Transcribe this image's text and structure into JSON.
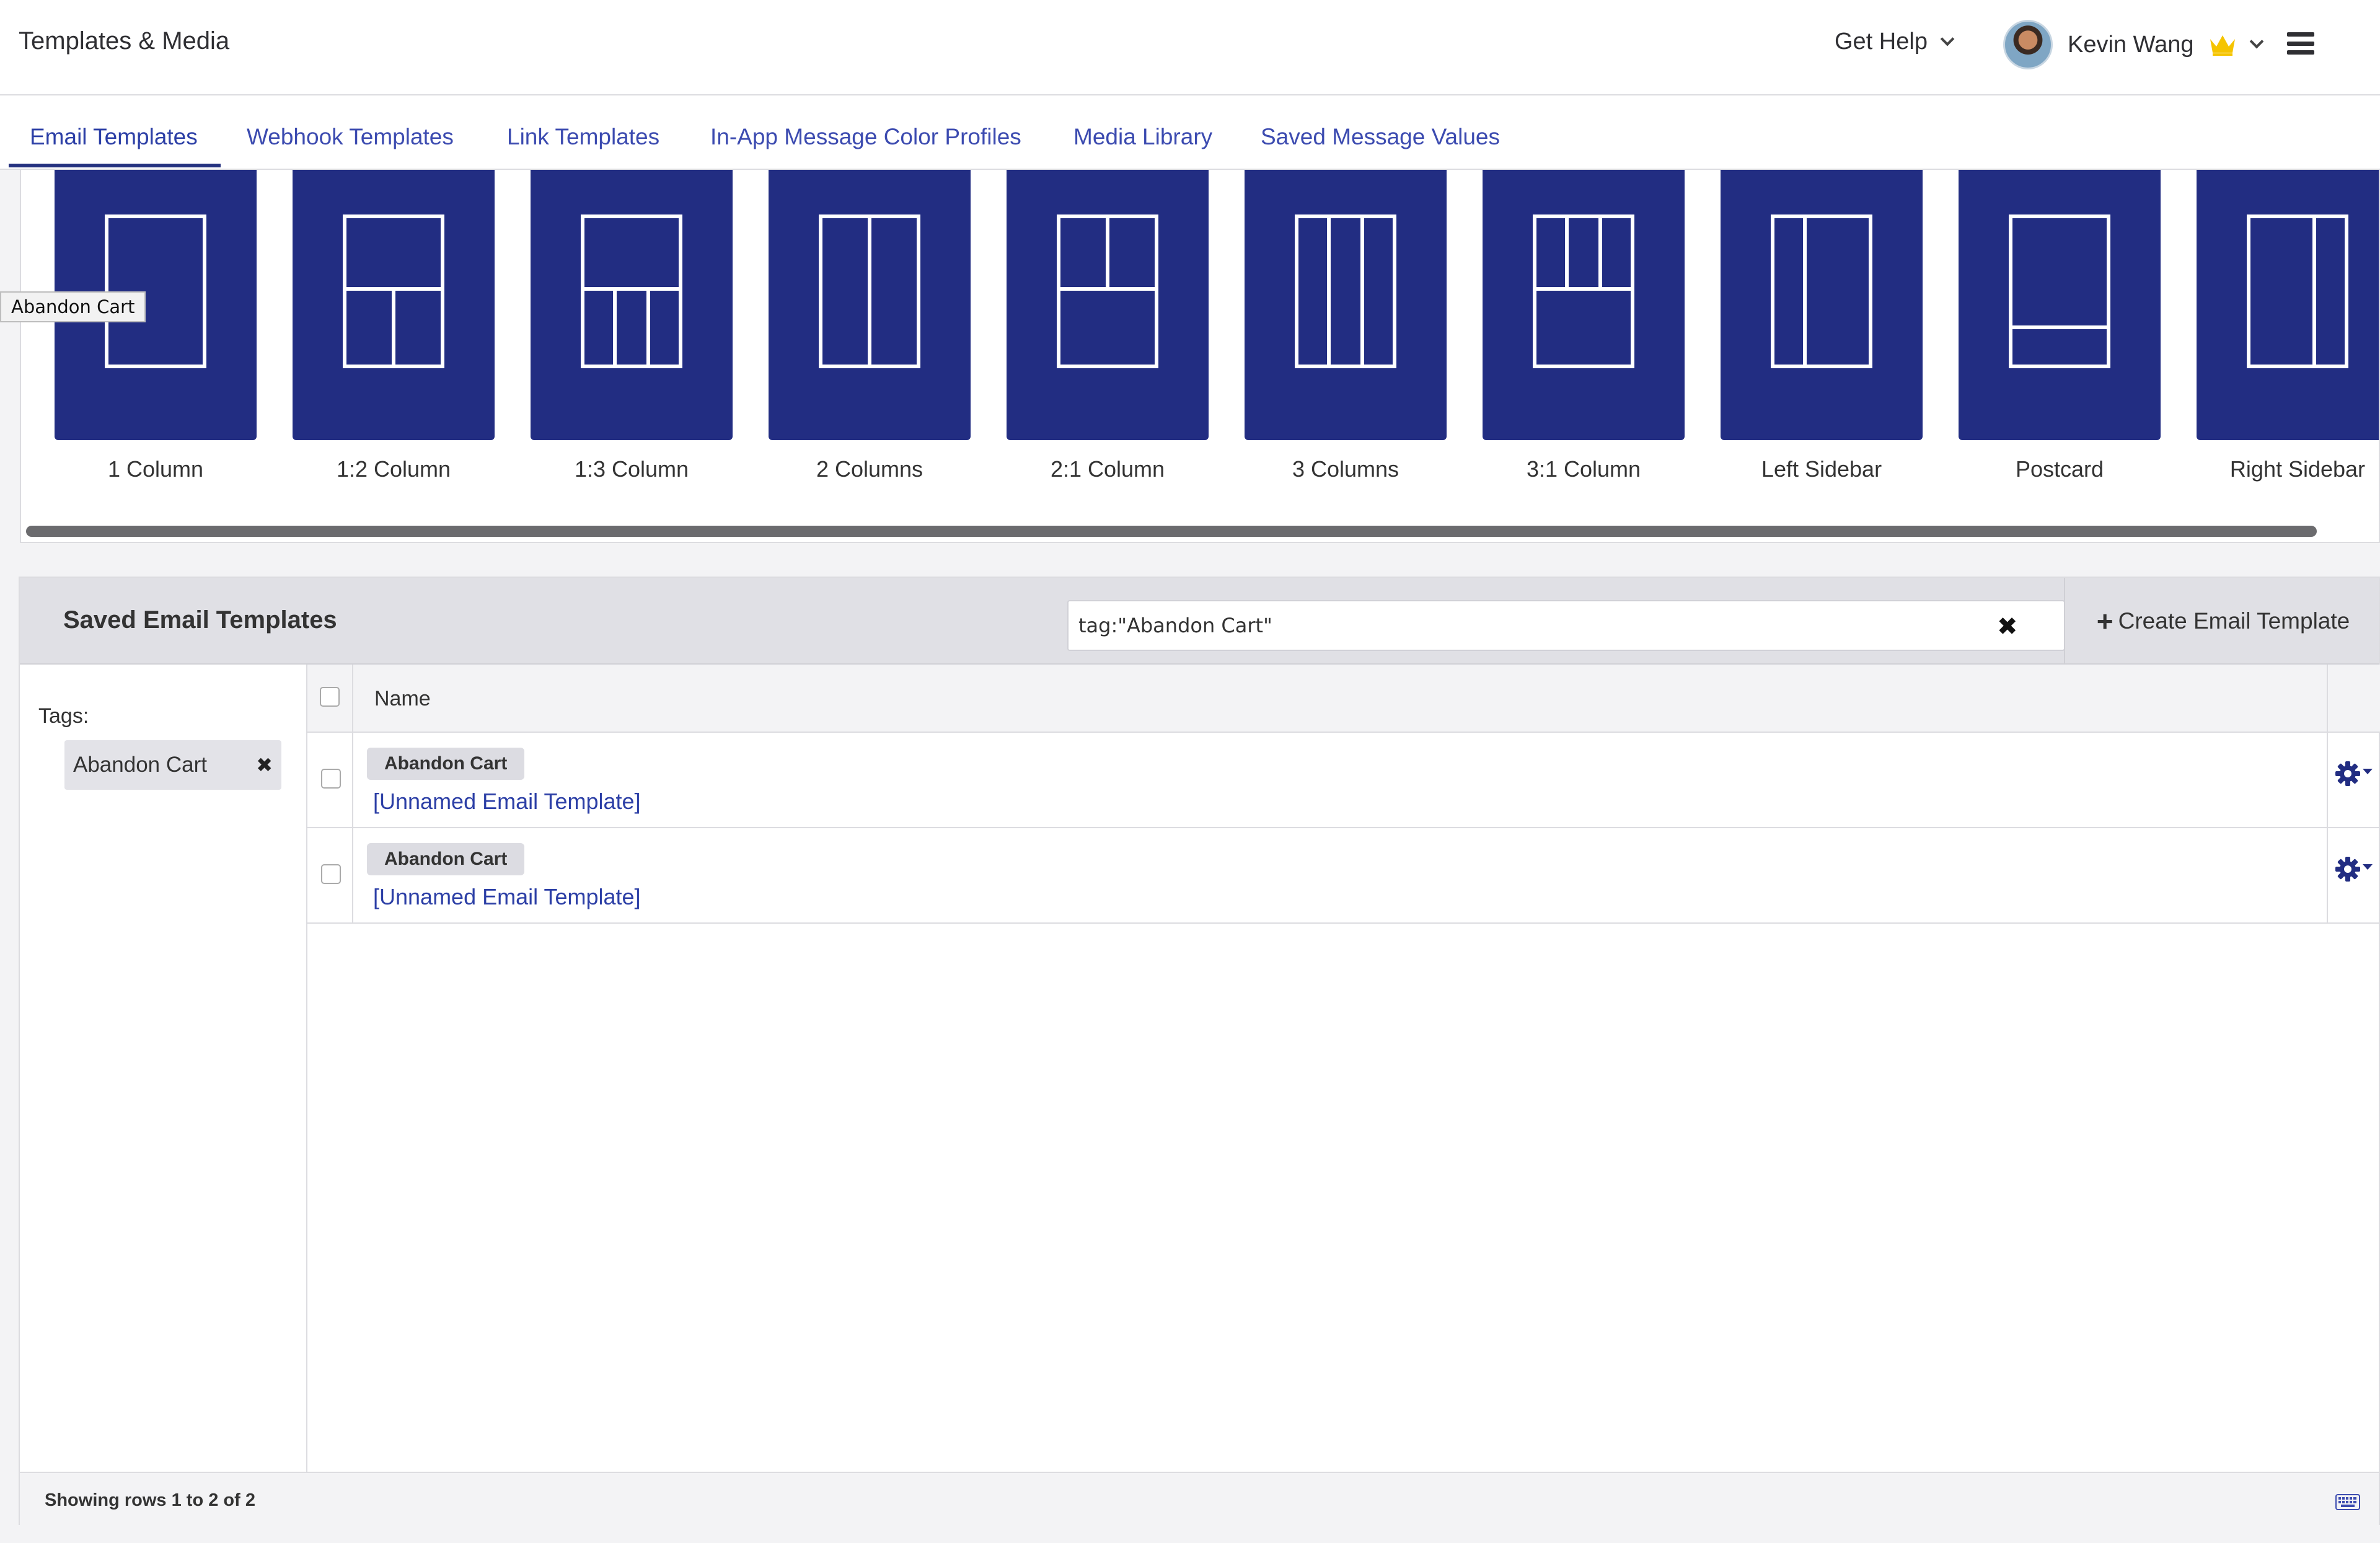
{
  "header": {
    "title": "Templates & Media",
    "help_label": "Get Help",
    "user_name": "Kevin Wang"
  },
  "tabs": [
    {
      "label": "Email Templates",
      "active": true
    },
    {
      "label": "Webhook Templates"
    },
    {
      "label": "Link Templates"
    },
    {
      "label": "In-App Message Color Profiles"
    },
    {
      "label": "Media Library"
    },
    {
      "label": "Saved Message Values"
    }
  ],
  "gallery": {
    "tooltip": "Abandon Cart",
    "templates": [
      {
        "label": "1 Column",
        "icon": "layout-1-column-icon"
      },
      {
        "label": "1:2 Column",
        "icon": "layout-1-2-column-icon"
      },
      {
        "label": "1:3 Column",
        "icon": "layout-1-3-column-icon"
      },
      {
        "label": "2 Columns",
        "icon": "layout-2-columns-icon"
      },
      {
        "label": "2:1 Column",
        "icon": "layout-2-1-column-icon"
      },
      {
        "label": "3 Columns",
        "icon": "layout-3-columns-icon"
      },
      {
        "label": "3:1 Column",
        "icon": "layout-3-1-column-icon"
      },
      {
        "label": "Left Sidebar",
        "icon": "layout-left-sidebar-icon"
      },
      {
        "label": "Postcard",
        "icon": "layout-postcard-icon"
      },
      {
        "label": "Right Sidebar",
        "icon": "layout-right-sidebar-icon"
      }
    ]
  },
  "saved": {
    "title": "Saved Email Templates",
    "search_value": "tag:\"Abandon Cart\"",
    "create_label": "Create Email Template",
    "tags_label": "Tags:",
    "active_tag": "Abandon Cart",
    "column_name": "Name",
    "rows": [
      {
        "tag": "Abandon Cart",
        "name": "[Unnamed Email Template]"
      },
      {
        "tag": "Abandon Cart",
        "name": "[Unnamed Email Template]"
      }
    ],
    "footer": "Showing rows 1 to 2 of 2"
  },
  "colors": {
    "brand_navy": "#222d82",
    "link_blue": "#2c3fa6",
    "crown_gold": "#f5c400"
  }
}
